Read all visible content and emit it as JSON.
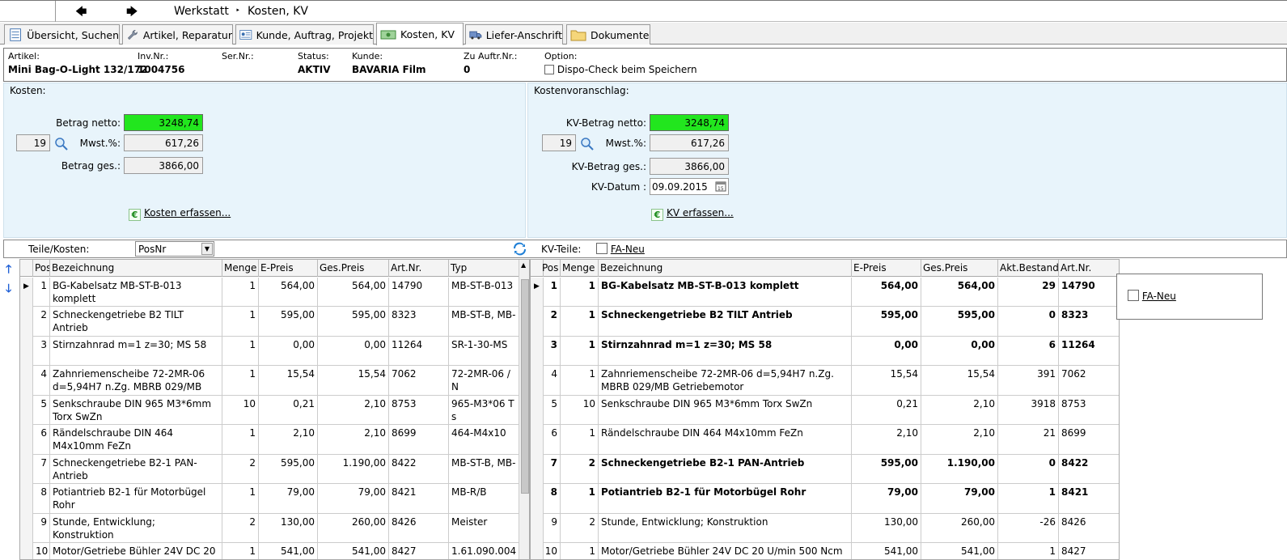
{
  "nav": {
    "back_icon": "arrow-left-icon",
    "forward_icon": "arrow-right-icon",
    "crumb1": "Werkstatt",
    "crumb_sep": "‣",
    "crumb2": "Kosten, KV"
  },
  "tabs": [
    {
      "label": "Übersicht, Suchen",
      "icon": "list-icon"
    },
    {
      "label": "Artikel, Reparatur",
      "icon": "wrench-icon"
    },
    {
      "label": "Kunde, Auftrag, Projekt",
      "icon": "contact-card-icon"
    },
    {
      "label": "Kosten, KV",
      "icon": "money-icon"
    },
    {
      "label": "Liefer-Anschrift",
      "icon": "truck-icon"
    },
    {
      "label": "Dokumente",
      "icon": "folder-icon"
    }
  ],
  "info": {
    "artikel_label": "Artikel:",
    "artikel": "Mini Bag-O-Light 132/172",
    "invnr_label": "Inv.Nr.:",
    "invnr": "1004756",
    "sernr_label": "Ser.Nr.:",
    "status_label": "Status:",
    "status": "AKTIV",
    "kunde_label": "Kunde:",
    "kunde": "BAVARIA Film",
    "zuauftr_label": "Zu Auftr.Nr.:",
    "zuauftr": "0",
    "option_label": "Option:",
    "option": "Dispo-Check beim Speichern"
  },
  "kosten": {
    "title": "Kosten:",
    "netto_label": "Betrag netto:",
    "netto": "3248,74",
    "mwst_rate": "19",
    "mwst_label": "Mwst.%:",
    "mwst": "617,26",
    "ges_label": "Betrag ges.:",
    "ges": "3866,00",
    "link": "Kosten erfassen..."
  },
  "kv": {
    "title": "Kostenvoranschlag:",
    "netto_label": "KV-Betrag netto:",
    "netto": "3248,74",
    "mwst_rate": "19",
    "mwst_label": "Mwst.%:",
    "mwst": "617,26",
    "ges_label": "KV-Betrag ges.:",
    "ges": "3866,00",
    "datum_label": "KV-Datum :",
    "datum": "09.09.2015",
    "link": "KV erfassen..."
  },
  "toolbar": {
    "teile_label": "Teile/Kosten:",
    "sort_value": "PosNr",
    "kvteile_label": "KV-Teile:",
    "faneu": "FA-Neu"
  },
  "popup": {
    "faneu": "FA-Neu"
  },
  "left_grid": {
    "headers": [
      "Pos",
      "Bezeichnung",
      "Menge",
      "E-Preis",
      "Ges.Preis",
      "Art.Nr.",
      "Typ"
    ],
    "rows": [
      [
        "1",
        "BG-Kabelsatz MB-ST-B-013 komplett",
        "1",
        "564,00",
        "564,00",
        "14790",
        "MB-ST-B-013"
      ],
      [
        "2",
        "Schneckengetriebe B2 TILT Antrieb",
        "1",
        "595,00",
        "595,00",
        "8323",
        "MB-ST-B, MB-"
      ],
      [
        "3",
        "Stirnzahnrad m=1 z=30; MS 58",
        "1",
        "0,00",
        "0,00",
        "11264",
        "SR-1-30-MS"
      ],
      [
        "4",
        "Zahnriemenscheibe 72-2MR-06 d=5,94H7 n.Zg. MBRB 029/MB",
        "1",
        "15,54",
        "15,54",
        "7062",
        "72-2MR-06 / N"
      ],
      [
        "5",
        "Senkschraube DIN 965 M3*6mm Torx SwZn",
        "10",
        "0,21",
        "2,10",
        "8753",
        "965-M3*06 T s"
      ],
      [
        "6",
        "Rändelschraube DIN 464 M4x10mm FeZn",
        "1",
        "2,10",
        "2,10",
        "8699",
        "464-M4x10"
      ],
      [
        "7",
        "Schneckengetriebe B2-1 PAN-Antrieb",
        "2",
        "595,00",
        "1.190,00",
        "8422",
        "MB-ST-B, MB-"
      ],
      [
        "8",
        "Potiantrieb B2-1 für Motorbügel Rohr",
        "1",
        "79,00",
        "79,00",
        "8421",
        "MB-R/B"
      ],
      [
        "9",
        "Stunde, Entwicklung; Konstruktion",
        "2",
        "130,00",
        "260,00",
        "8426",
        "Meister"
      ],
      [
        "10",
        "Motor/Getriebe Bühler 24V DC 20",
        "1",
        "541,00",
        "541,00",
        "8427",
        "1.61.090.004"
      ]
    ]
  },
  "right_grid": {
    "headers": [
      "Pos",
      "Menge",
      "Bezeichnung",
      "E-Preis",
      "Ges.Preis",
      "Akt.Bestand",
      "Art.Nr."
    ],
    "rows": [
      [
        "1",
        "1",
        "BG-Kabelsatz MB-ST-B-013 komplett",
        "564,00",
        "564,00",
        "29",
        "14790"
      ],
      [
        "2",
        "1",
        "Schneckengetriebe B2 TILT Antrieb",
        "595,00",
        "595,00",
        "0",
        "8323"
      ],
      [
        "3",
        "1",
        "Stirnzahnrad m=1 z=30; MS 58",
        "0,00",
        "0,00",
        "6",
        "11264"
      ],
      [
        "4",
        "1",
        "Zahnriemenscheibe 72-2MR-06 d=5,94H7 n.Zg. MBRB 029/MB Getriebemotor",
        "15,54",
        "15,54",
        "391",
        "7062"
      ],
      [
        "5",
        "10",
        "Senkschraube DIN 965 M3*6mm Torx SwZn",
        "0,21",
        "2,10",
        "3918",
        "8753"
      ],
      [
        "6",
        "1",
        "Rändelschraube DIN 464 M4x10mm FeZn",
        "2,10",
        "2,10",
        "21",
        "8699"
      ],
      [
        "7",
        "2",
        "Schneckengetriebe B2-1 PAN-Antrieb",
        "595,00",
        "1.190,00",
        "0",
        "8422"
      ],
      [
        "8",
        "1",
        "Potiantrieb B2-1 für Motorbügel Rohr",
        "79,00",
        "79,00",
        "1",
        "8421"
      ],
      [
        "9",
        "2",
        "Stunde, Entwicklung; Konstruktion",
        "130,00",
        "260,00",
        "-26",
        "8426"
      ],
      [
        "10",
        "1",
        "Motor/Getriebe Bühler 24V DC 20 U/min 500 Ncm",
        "541,00",
        "541,00",
        "1",
        "8427"
      ]
    ],
    "bold_rows": [
      0,
      1,
      2,
      6,
      7
    ]
  },
  "colors": {
    "accent_green": "#22e61e",
    "panel_bg": "#e8f4fb"
  }
}
